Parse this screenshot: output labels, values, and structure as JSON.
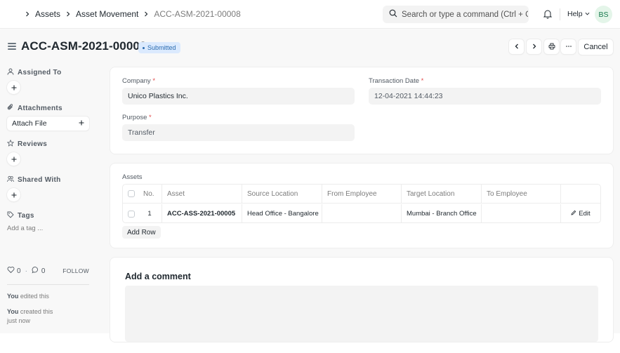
{
  "navbar": {
    "breadcrumbs": [
      {
        "label": "Assets"
      },
      {
        "label": "Asset Movement"
      },
      {
        "label": "ACC-ASM-2021-00008"
      }
    ],
    "search": {
      "placeholder": "Search or type a command (Ctrl + G)",
      "value": ""
    },
    "icons": {
      "search": "search-icon",
      "notifications": "bell-icon",
      "chevron": "chevron-down-icon"
    },
    "help_label": "Help",
    "avatar_initials": "BS"
  },
  "header": {
    "title": "ACC-ASM-2021-00008",
    "status": "Submitted",
    "status_color": "#2b6cb0",
    "status_bg": "#dbeafe",
    "actions": {
      "prev": "chevron-left-icon",
      "next": "chevron-right-icon",
      "print": "printer-icon",
      "more": "more-horizontal-icon",
      "cancel_label": "Cancel"
    }
  },
  "sidebar": {
    "assigned_to": "Assigned To",
    "attachments": "Attachments",
    "attach_file": "Attach File",
    "reviews": "Reviews",
    "shared_with": "Shared With",
    "tags": "Tags",
    "add_tag": "Add a tag ...",
    "likes": "0",
    "comments": "0",
    "separator": "·",
    "follow": "FOLLOW",
    "activity": [
      {
        "actor": "You",
        "text": " edited this",
        "time": ""
      },
      {
        "actor": "You",
        "text": " created this",
        "time": "just now"
      }
    ]
  },
  "form": {
    "company": {
      "label": "Company",
      "required": "*",
      "value": "Unico Plastics Inc."
    },
    "transaction_date": {
      "label": "Transaction Date",
      "required": "*",
      "value": "12-04-2021 14:44:23"
    },
    "purpose": {
      "label": "Purpose",
      "required": "*",
      "value": "Transfer"
    }
  },
  "assets_table": {
    "label": "Assets",
    "columns": [
      "No.",
      "Asset",
      "Source Location",
      "From Employee",
      "Target Location",
      "To Employee",
      ""
    ],
    "rows": [
      {
        "no": "1",
        "asset": "ACC-ASS-2021-00005",
        "source_location": "Head Office - Bangalore",
        "from_employee": "",
        "target_location": "Mumbai - Branch Office",
        "to_employee": "",
        "action": "Edit"
      }
    ],
    "add_row_label": "Add Row"
  },
  "comment": {
    "title": "Add a comment",
    "value": ""
  }
}
